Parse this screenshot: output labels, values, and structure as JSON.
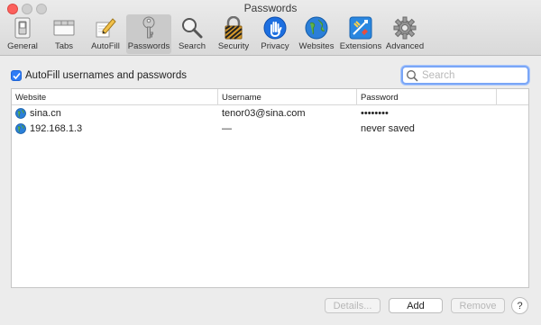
{
  "window": {
    "title": "Passwords"
  },
  "toolbar": {
    "items": [
      {
        "label": "General",
        "icon": "general-switch-icon"
      },
      {
        "label": "Tabs",
        "icon": "tabs-icon"
      },
      {
        "label": "AutoFill",
        "icon": "pencil-icon"
      },
      {
        "label": "Passwords",
        "icon": "key-icon",
        "active": true
      },
      {
        "label": "Search",
        "icon": "magnifier-icon"
      },
      {
        "label": "Security",
        "icon": "lock-icon"
      },
      {
        "label": "Privacy",
        "icon": "hand-icon"
      },
      {
        "label": "Websites",
        "icon": "globe-icon"
      },
      {
        "label": "Extensions",
        "icon": "extensions-icon"
      },
      {
        "label": "Advanced",
        "icon": "gear-icon"
      }
    ]
  },
  "autofill": {
    "label": "AutoFill usernames and passwords",
    "checked": true
  },
  "search": {
    "placeholder": "Search",
    "value": ""
  },
  "table": {
    "columns": [
      "Website",
      "Username",
      "Password"
    ],
    "rows": [
      {
        "website": "sina.cn",
        "username": "tenor03@sina.com",
        "password": "••••••••"
      },
      {
        "website": "192.168.1.3",
        "username": "—",
        "password": "never saved"
      }
    ]
  },
  "buttons": {
    "details": "Details...",
    "add": "Add",
    "remove": "Remove",
    "help": "?"
  },
  "colors": {
    "accent": "#2f7cf6",
    "close": "#fc605c"
  }
}
